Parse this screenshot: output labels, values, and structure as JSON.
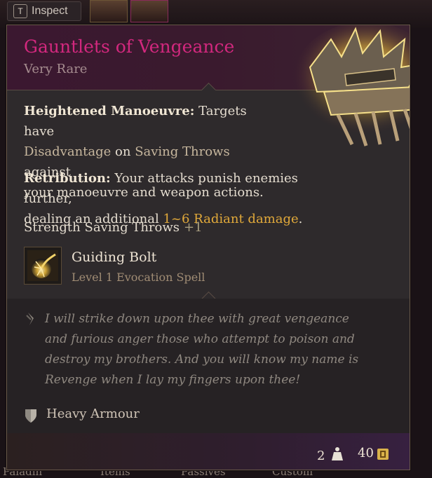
{
  "inspect": {
    "key": "T",
    "label": "Inspect"
  },
  "bottom_tabs": [
    "Paladin",
    "Items",
    "Passives",
    "Custom"
  ],
  "item": {
    "name": "Gauntlets of Vengeance",
    "rarity": "Very Rare",
    "name_color": "#d2287e"
  },
  "properties": [
    {
      "title": "Heightened Manoeuvre:",
      "line1_a": "Targets have",
      "line2_hl": "Disadvantage",
      "line2_b": " on ",
      "line2_hl2": "Saving Throws",
      "line2_c": " against",
      "line3": "your manoeuvre and weapon actions."
    },
    {
      "title": "Retribution:",
      "line1_a": "Your attacks punish enemies further,",
      "line2_a": "dealing an additional ",
      "line2_hl": "1~6 Radiant damage",
      "line2_c": "."
    }
  ],
  "stat": {
    "label": "Strength Saving Throws",
    "value": "+1"
  },
  "spell": {
    "name": "Guiding Bolt",
    "level": "Level 1 Evocation Spell",
    "icon": "guiding-bolt-icon"
  },
  "quote": "I will strike down upon thee with great vengeance and furious anger those who attempt to poison and destroy my brothers. And you will know my name is Revenge when I lay my fingers upon thee!",
  "armour_type": "Heavy Armour",
  "footer": {
    "weight": "2",
    "price": "40"
  }
}
